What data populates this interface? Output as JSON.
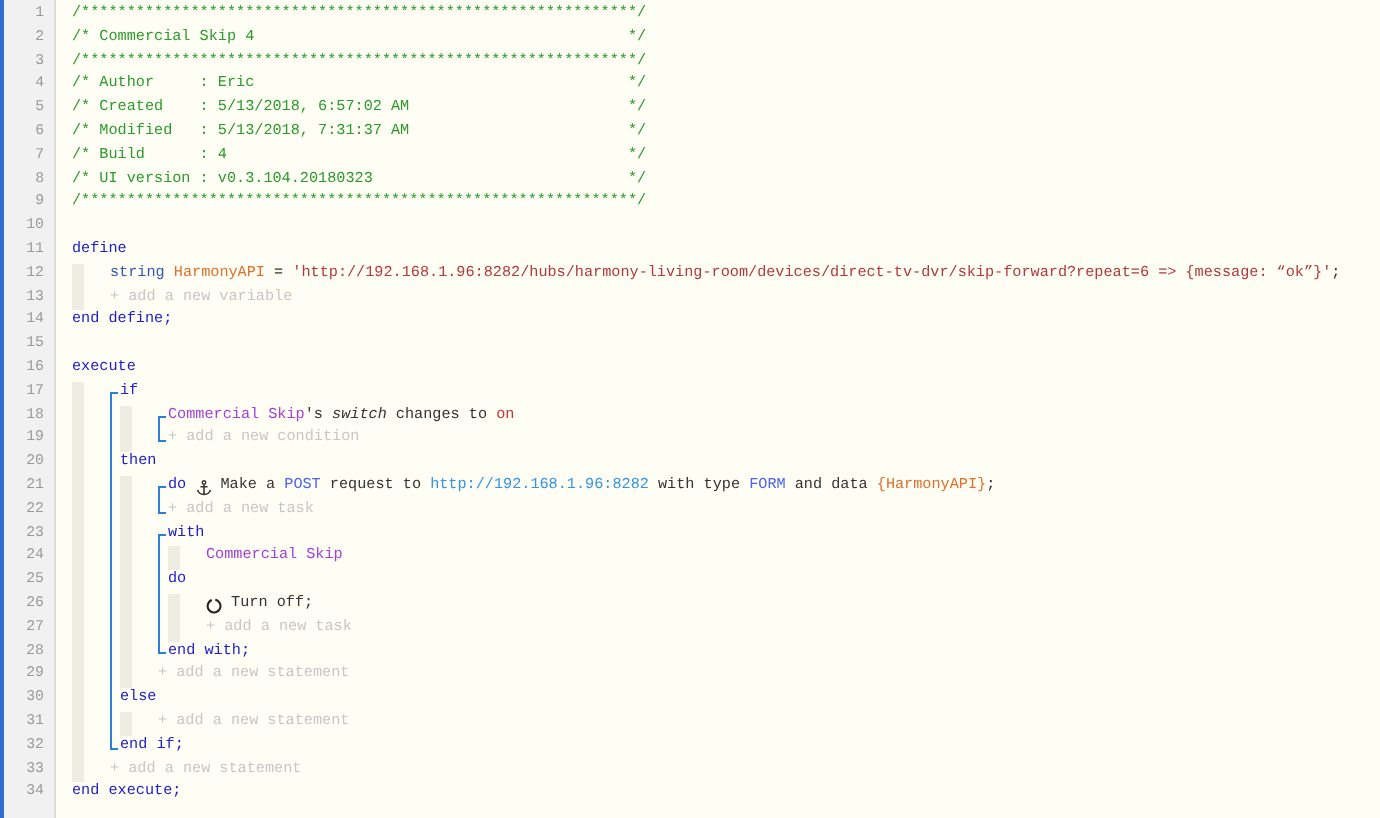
{
  "editor": {
    "lines": [
      {
        "kind": "comment",
        "number": "1",
        "text": "/*************************************************************/"
      },
      {
        "kind": "comment",
        "number": "2",
        "text": "/* Commercial Skip 4",
        "close": "*/"
      },
      {
        "kind": "comment",
        "number": "3",
        "text": "/*************************************************************/"
      },
      {
        "kind": "comment",
        "number": "4",
        "text": "/* Author     : Eric",
        "close": "*/"
      },
      {
        "kind": "comment",
        "number": "5",
        "text": "/* Created    : 5/13/2018, 6:57:02 AM",
        "close": "*/"
      },
      {
        "kind": "comment",
        "number": "6",
        "text": "/* Modified   : 5/13/2018, 7:31:37 AM",
        "close": "*/"
      },
      {
        "kind": "comment",
        "number": "7",
        "text": "/* Build      : 4",
        "close": "*/"
      },
      {
        "kind": "comment",
        "number": "8",
        "text": "/* UI version : v0.3.104.20180323",
        "close": "*/"
      },
      {
        "kind": "comment",
        "number": "9",
        "text": "/*************************************************************/"
      },
      {
        "kind": "line",
        "number": "10"
      },
      {
        "kind": "line",
        "number": "11",
        "segments": [
          {
            "kind": "keyword",
            "text": "define"
          }
        ],
        "children": [
          {
            "kind": "line",
            "number": "12",
            "segments": [
              {
                "kind": "type",
                "text": "string "
              },
              {
                "kind": "variable",
                "text": "HarmonyAPI"
              },
              {
                "kind": "text",
                "text": " = "
              },
              {
                "kind": "string",
                "text": "'http://192.168.1.96:8282/hubs/harmony-living-room/devices/direct-tv-dvr/skip-forward?repeat=6 => {message: “ok”}'"
              },
              {
                "kind": "text",
                "text": ";"
              }
            ]
          },
          {
            "kind": "line",
            "number": "13",
            "segments": [
              {
                "kind": "hint",
                "text": "+ add a new variable"
              }
            ]
          }
        ]
      },
      {
        "kind": "line",
        "number": "14",
        "segments": [
          {
            "kind": "keyword",
            "text": "end define;"
          }
        ]
      },
      {
        "kind": "line",
        "number": "15"
      },
      {
        "kind": "line",
        "number": "16",
        "segments": [
          {
            "kind": "keyword",
            "text": "execute"
          }
        ],
        "children": [
          {
            "kind": "block",
            "bracketed": true,
            "items": [
              {
                "kind": "line",
                "number": "17",
                "segments": [
                  {
                    "kind": "keyword",
                    "text": "if"
                  }
                ],
                "children": [
                  {
                    "kind": "block",
                    "bracketed": true,
                    "items": [
                      {
                        "kind": "line",
                        "number": "18",
                        "segments": [
                          {
                            "kind": "device",
                            "text": "Commercial Skip"
                          },
                          {
                            "kind": "text",
                            "text": "'s "
                          },
                          {
                            "kind": "attribute",
                            "text": "switch"
                          },
                          {
                            "kind": "text",
                            "text": " changes to "
                          },
                          {
                            "kind": "value",
                            "text": "on"
                          }
                        ]
                      },
                      {
                        "kind": "line",
                        "number": "19",
                        "segments": [
                          {
                            "kind": "hint",
                            "text": "+ add a new condition"
                          }
                        ]
                      }
                    ]
                  }
                ]
              },
              {
                "kind": "line",
                "number": "20",
                "segments": [
                  {
                    "kind": "keyword",
                    "text": "then"
                  }
                ],
                "children": [
                  {
                    "kind": "block",
                    "bracketed": true,
                    "items": [
                      {
                        "kind": "line",
                        "number": "21",
                        "segments": [
                          {
                            "kind": "keyword",
                            "text": "do "
                          },
                          {
                            "kind": "anchor"
                          },
                          {
                            "kind": "text",
                            "text": " Make a "
                          },
                          {
                            "kind": "constant",
                            "text": "POST"
                          },
                          {
                            "kind": "text",
                            "text": " request to "
                          },
                          {
                            "kind": "url",
                            "text": "http://192.168.1.96:8282"
                          },
                          {
                            "kind": "text",
                            "text": " with type "
                          },
                          {
                            "kind": "constant",
                            "text": "FORM"
                          },
                          {
                            "kind": "text",
                            "text": " and data "
                          },
                          {
                            "kind": "variable",
                            "text": "{HarmonyAPI}"
                          },
                          {
                            "kind": "text",
                            "text": ";"
                          }
                        ]
                      },
                      {
                        "kind": "line",
                        "number": "22",
                        "segments": [
                          {
                            "kind": "hint",
                            "text": "+ add a new task"
                          }
                        ]
                      }
                    ]
                  },
                  {
                    "kind": "block",
                    "bracketed": true,
                    "items": [
                      {
                        "kind": "line",
                        "number": "23",
                        "segments": [
                          {
                            "kind": "keyword",
                            "text": "with"
                          }
                        ],
                        "children": [
                          {
                            "kind": "line",
                            "number": "24",
                            "segments": [
                              {
                                "kind": "device",
                                "text": "Commercial Skip"
                              }
                            ]
                          }
                        ]
                      },
                      {
                        "kind": "line",
                        "number": "25",
                        "segments": [
                          {
                            "kind": "keyword",
                            "text": "do"
                          }
                        ],
                        "children": [
                          {
                            "kind": "line",
                            "number": "26",
                            "segments": [
                              {
                                "kind": "power"
                              },
                              {
                                "kind": "text",
                                "text": " Turn off;"
                              }
                            ]
                          },
                          {
                            "kind": "line",
                            "number": "27",
                            "segments": [
                              {
                                "kind": "hint",
                                "text": "+ add a new task"
                              }
                            ]
                          }
                        ]
                      },
                      {
                        "kind": "line",
                        "number": "28",
                        "segments": [
                          {
                            "kind": "keyword",
                            "text": "end with;"
                          }
                        ]
                      }
                    ]
                  },
                  {
                    "kind": "line",
                    "number": "29",
                    "segments": [
                      {
                        "kind": "hint",
                        "text": "+ add a new statement"
                      }
                    ]
                  }
                ]
              },
              {
                "kind": "line",
                "number": "30",
                "segments": [
                  {
                    "kind": "keyword",
                    "text": "else"
                  }
                ],
                "children": [
                  {
                    "kind": "line",
                    "number": "31",
                    "segments": [
                      {
                        "kind": "hint",
                        "text": "+ add a new statement"
                      }
                    ]
                  }
                ]
              },
              {
                "kind": "line",
                "number": "32",
                "segments": [
                  {
                    "kind": "keyword",
                    "text": "end if;"
                  }
                ]
              }
            ]
          },
          {
            "kind": "line",
            "number": "33",
            "segments": [
              {
                "kind": "hint",
                "text": "+ add a new statement"
              }
            ]
          }
        ]
      },
      {
        "kind": "line",
        "number": "34",
        "segments": [
          {
            "kind": "keyword",
            "text": "end execute;"
          }
        ]
      }
    ]
  }
}
